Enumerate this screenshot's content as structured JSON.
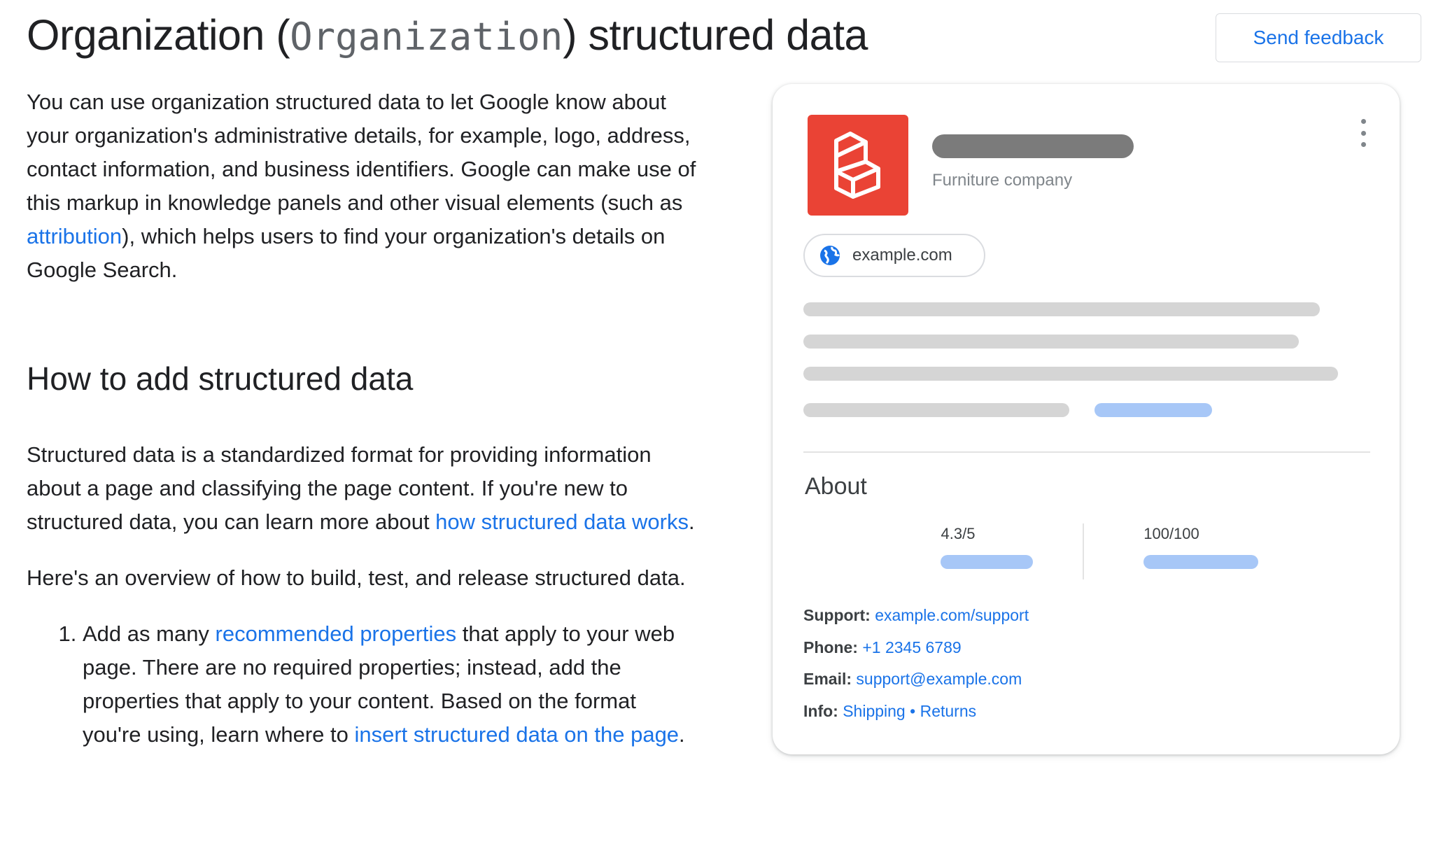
{
  "header": {
    "title_before": "Organization (",
    "title_code": "Organization",
    "title_after": ") structured data",
    "feedback_label": "Send feedback"
  },
  "article": {
    "intro_before": "You can use organization structured data to let Google know about your organization's administrative details, for example, logo, address, contact information, and business identifiers. Google can make use of this markup in knowledge panels and other visual elements (such as ",
    "intro_link": "attribution",
    "intro_after": "), which helps users to find your organization's details on Google Search.",
    "heading": "How to add structured data",
    "p2_before": "Structured data is a standardized format for providing information about a page and classifying the page content. If you're new to structured data, you can learn more about ",
    "p2_link": "how structured data works",
    "p2_after": ".",
    "p3": "Here's an overview of how to build, test, and release structured data.",
    "step1_before": "Add as many ",
    "step1_link1": "recommended properties",
    "step1_middle": " that apply to your web page. There are no required properties; instead, add the properties that apply to your content. Based on the format you're using, learn where to ",
    "step1_link2": "insert structured data on the page",
    "step1_after": "."
  },
  "card": {
    "subtitle": "Furniture company",
    "website": "example.com",
    "about_title": "About",
    "stat1": "4.3/5",
    "stat2": "100/100",
    "support_label": "Support:",
    "support_value": "example.com/support",
    "phone_label": "Phone:",
    "phone_value": "+1 2345 6789",
    "email_label": "Email:",
    "email_value": "support@example.com",
    "info_label": "Info:",
    "info_link1": "Shipping",
    "info_sep": " • ",
    "info_link2": "Returns"
  },
  "icons": {
    "logo": "box-cube-logo-icon",
    "globe": "globe-icon",
    "more": "more-vert-icon"
  },
  "colors": {
    "link": "#1a73e8",
    "logo_bg": "#ea4335",
    "skeleton": "#d5d5d5",
    "skeleton_accent": "#a7c7f7"
  }
}
